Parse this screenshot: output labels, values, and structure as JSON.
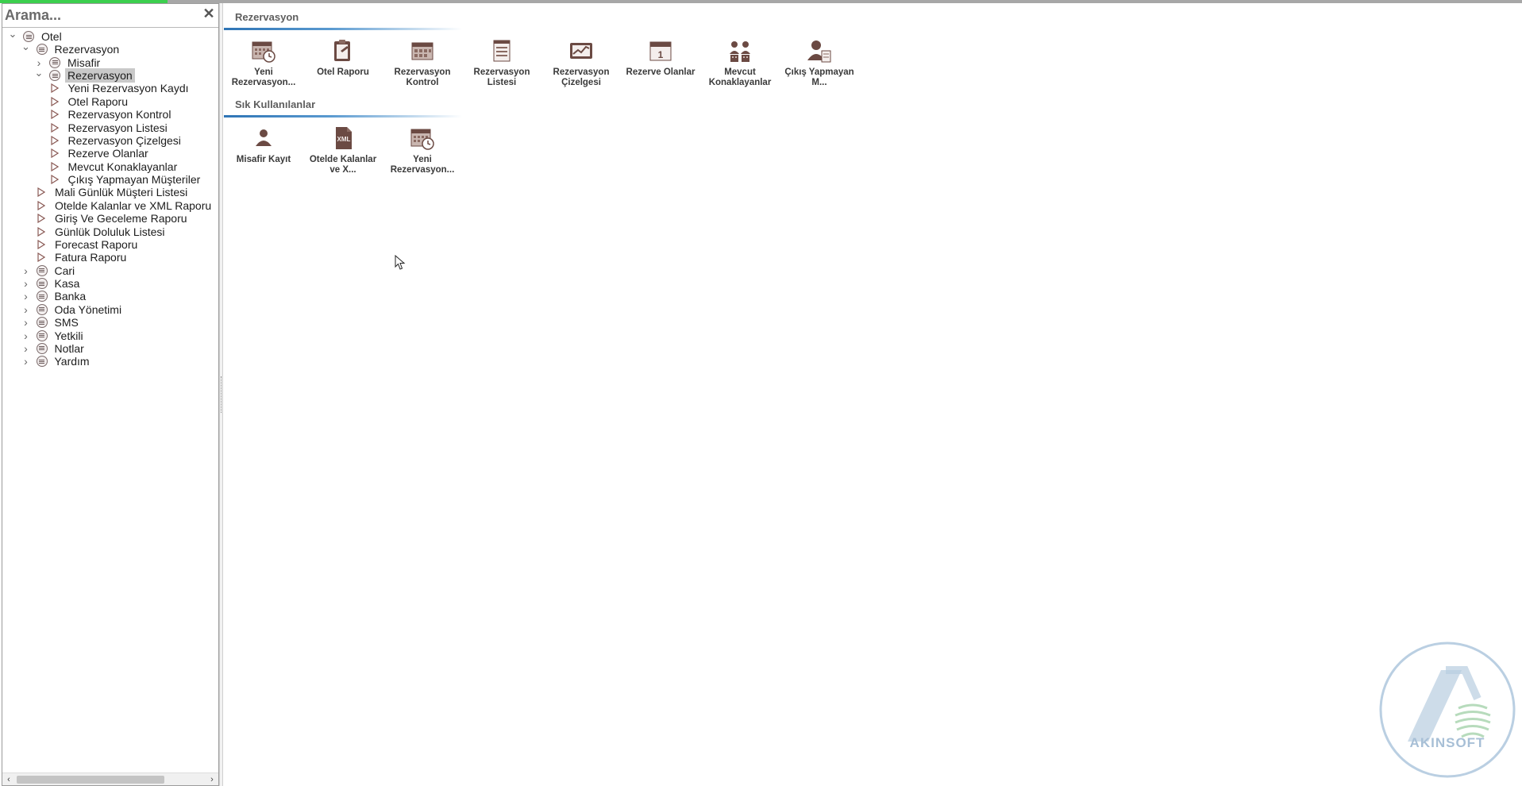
{
  "progress": {
    "fraction": 0.11,
    "color": "#3ccf4e"
  },
  "search": {
    "text": "Arama...",
    "close_icon": "close-icon"
  },
  "tree": [
    {
      "label": "Otel",
      "icon": "node-icon",
      "expander": "expanded",
      "selected": false
    },
    {
      "label": "Rezervasyon",
      "icon": "node-icon",
      "expander": "expanded",
      "selected": false
    },
    {
      "label": "Misafir",
      "icon": "node-icon",
      "expander": "collapsed",
      "selected": false
    },
    {
      "label": "Rezervasyon",
      "icon": "node-icon",
      "expander": "expanded",
      "selected": true
    },
    {
      "label": "Yeni Rezervasyon Kaydı",
      "icon": "triangle-icon",
      "expander": "none",
      "selected": false
    },
    {
      "label": "Otel Raporu",
      "icon": "triangle-icon",
      "expander": "none",
      "selected": false
    },
    {
      "label": "Rezervasyon Kontrol",
      "icon": "triangle-icon",
      "expander": "none",
      "selected": false
    },
    {
      "label": "Rezervasyon Listesi",
      "icon": "triangle-icon",
      "expander": "none",
      "selected": false
    },
    {
      "label": "Rezervasyon Çizelgesi",
      "icon": "triangle-icon",
      "expander": "none",
      "selected": false
    },
    {
      "label": "Rezerve Olanlar",
      "icon": "triangle-icon",
      "expander": "none",
      "selected": false
    },
    {
      "label": "Mevcut Konaklayanlar",
      "icon": "triangle-icon",
      "expander": "none",
      "selected": false
    },
    {
      "label": "Çıkış Yapmayan Müşteriler",
      "icon": "triangle-icon",
      "expander": "none",
      "selected": false
    },
    {
      "label": "Mali Günlük Müşteri Listesi",
      "icon": "triangle-icon",
      "expander": "none",
      "selected": false
    },
    {
      "label": "Otelde Kalanlar ve XML Raporu",
      "icon": "triangle-icon",
      "expander": "none",
      "selected": false
    },
    {
      "label": "Giriş Ve Geceleme Raporu",
      "icon": "triangle-icon",
      "expander": "none",
      "selected": false
    },
    {
      "label": "Günlük Doluluk Listesi",
      "icon": "triangle-icon",
      "expander": "none",
      "selected": false
    },
    {
      "label": "Forecast Raporu",
      "icon": "triangle-icon",
      "expander": "none",
      "selected": false
    },
    {
      "label": "Fatura Raporu",
      "icon": "triangle-icon",
      "expander": "none",
      "selected": false
    },
    {
      "label": "Cari",
      "icon": "node-icon",
      "expander": "collapsed",
      "selected": false
    },
    {
      "label": "Kasa",
      "icon": "node-icon",
      "expander": "collapsed",
      "selected": false
    },
    {
      "label": "Banka",
      "icon": "node-icon",
      "expander": "collapsed",
      "selected": false
    },
    {
      "label": "Oda Yönetimi",
      "icon": "node-icon",
      "expander": "collapsed",
      "selected": false
    },
    {
      "label": "SMS",
      "icon": "node-icon",
      "expander": "collapsed",
      "selected": false
    },
    {
      "label": "Yetkili",
      "icon": "node-icon",
      "expander": "collapsed",
      "selected": false
    },
    {
      "label": "Notlar",
      "icon": "node-icon",
      "expander": "collapsed",
      "selected": false
    },
    {
      "label": "Yardım",
      "icon": "node-icon",
      "expander": "collapsed",
      "selected": false
    }
  ],
  "groups": [
    {
      "title": "Rezervasyon",
      "tiles": [
        {
          "label": "Yeni Rezervasyon...",
          "icon": "calendar-clock-icon"
        },
        {
          "label": "Otel Raporu",
          "icon": "clipboard-icon"
        },
        {
          "label": "Rezervasyon Kontrol",
          "icon": "calendar-grid-icon"
        },
        {
          "label": "Rezervasyon Listesi",
          "icon": "list-icon"
        },
        {
          "label": "Rezervasyon Çizelgesi",
          "icon": "chart-board-icon"
        },
        {
          "label": "Rezerve Olanlar",
          "icon": "calendar-day-icon"
        },
        {
          "label": "Mevcut Konaklayanlar",
          "icon": "people-icon"
        },
        {
          "label": "Çıkış Yapmayan M...",
          "icon": "person-doc-icon"
        }
      ]
    },
    {
      "title": "Sık Kullanılanlar",
      "tiles": [
        {
          "label": "Misafir Kayıt",
          "icon": "person-icon"
        },
        {
          "label": "Otelde Kalanlar ve X...",
          "icon": "xml-file-icon"
        },
        {
          "label": "Yeni Rezervasyon...",
          "icon": "calendar-clock-icon"
        }
      ]
    }
  ],
  "logo": {
    "text": "AKINSOFT"
  },
  "colors": {
    "accent": "#2e74b5",
    "icon_brown": "#6b4a43",
    "selection": "#c9c9c9"
  }
}
